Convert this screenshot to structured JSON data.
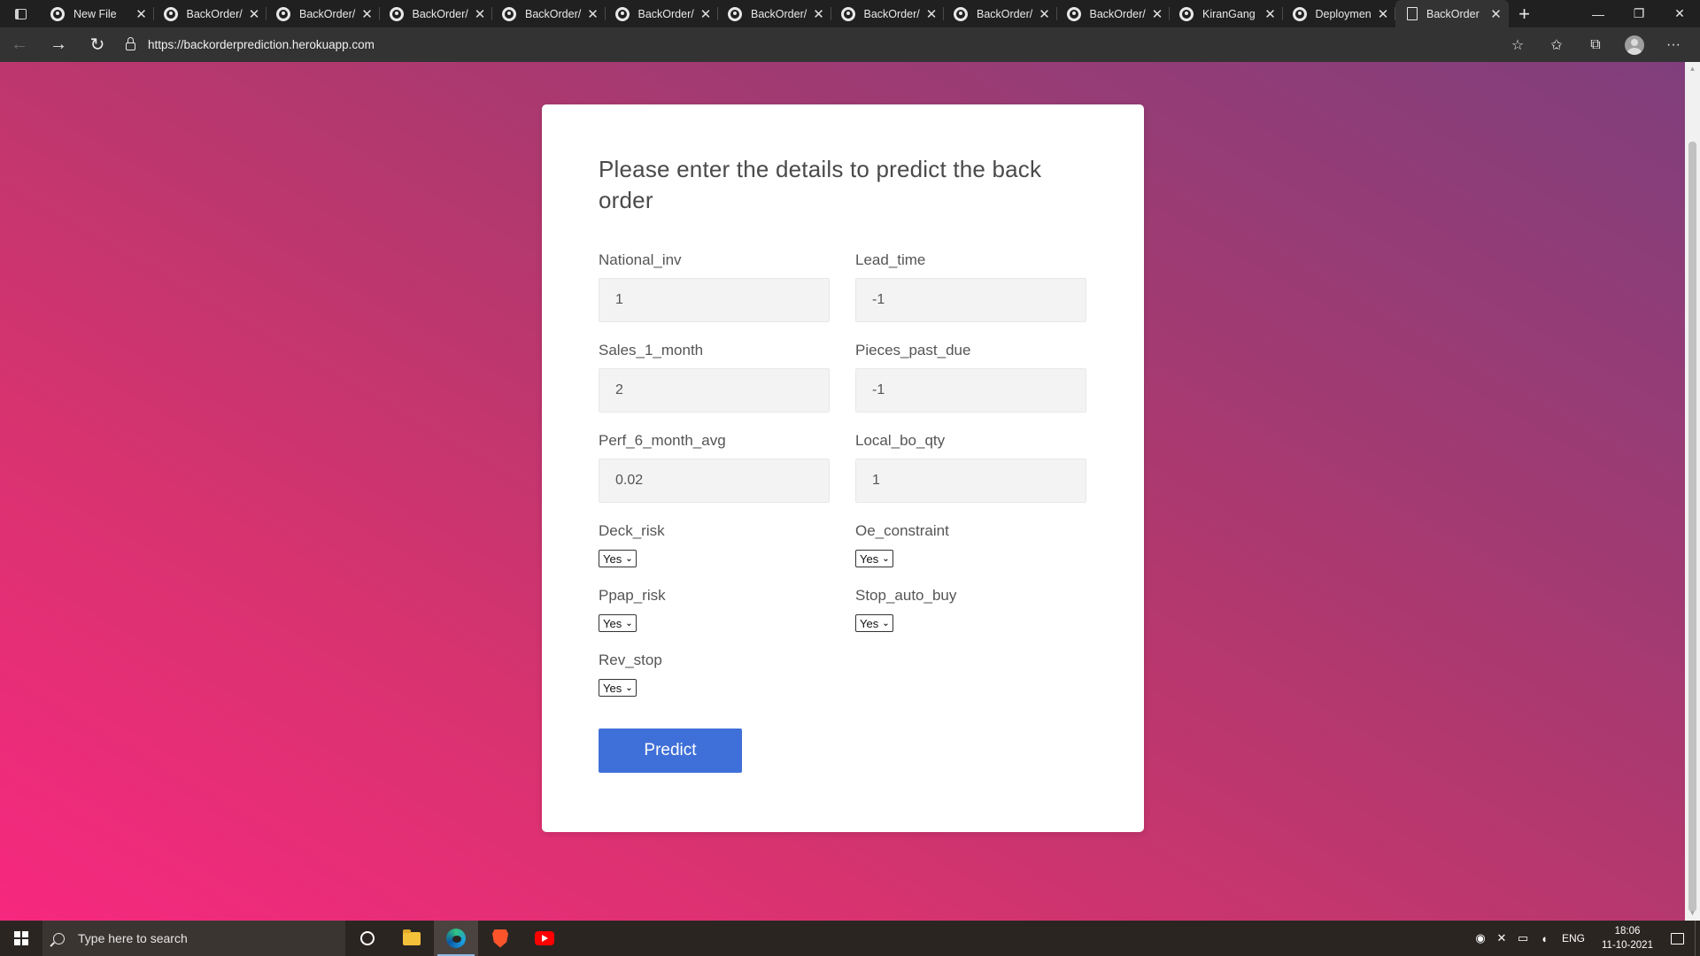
{
  "browser": {
    "tabs": [
      {
        "title": "New File",
        "icon": "github-icon",
        "active": false
      },
      {
        "title": "BackOrder/",
        "icon": "github-icon",
        "active": false
      },
      {
        "title": "BackOrder/",
        "icon": "github-icon",
        "active": false
      },
      {
        "title": "BackOrder/",
        "icon": "github-icon",
        "active": false
      },
      {
        "title": "BackOrder/",
        "icon": "github-icon",
        "active": false
      },
      {
        "title": "BackOrder/",
        "icon": "github-icon",
        "active": false
      },
      {
        "title": "BackOrder/",
        "icon": "github-icon",
        "active": false
      },
      {
        "title": "BackOrder/",
        "icon": "github-icon",
        "active": false
      },
      {
        "title": "BackOrder/",
        "icon": "github-icon",
        "active": false
      },
      {
        "title": "BackOrder/",
        "icon": "github-icon",
        "active": false
      },
      {
        "title": "KiranGang",
        "icon": "github-icon",
        "active": false
      },
      {
        "title": "Deploymen",
        "icon": "github-icon",
        "active": false
      },
      {
        "title": "BackOrder",
        "icon": "document-icon",
        "active": true
      }
    ],
    "url": "https://backorderprediction.herokuapp.com"
  },
  "form": {
    "heading": "Please enter the details to predict the back order",
    "fields": {
      "national_inv": {
        "label": "National_inv",
        "value": "1"
      },
      "lead_time": {
        "label": "Lead_time",
        "value": "-1"
      },
      "sales_1_month": {
        "label": "Sales_1_month",
        "value": "2"
      },
      "pieces_past_due": {
        "label": "Pieces_past_due",
        "value": "-1"
      },
      "perf_6_month_avg": {
        "label": "Perf_6_month_avg",
        "value": "0.02"
      },
      "local_bo_qty": {
        "label": "Local_bo_qty",
        "value": "1"
      }
    },
    "selects": {
      "deck_risk": {
        "label": "Deck_risk",
        "value": "Yes"
      },
      "oe_constraint": {
        "label": "Oe_constraint",
        "value": "Yes"
      },
      "ppap_risk": {
        "label": "Ppap_risk",
        "value": "Yes"
      },
      "stop_auto_buy": {
        "label": "Stop_auto_buy",
        "value": "Yes"
      },
      "rev_stop": {
        "label": "Rev_stop",
        "value": "Yes"
      }
    },
    "submit_label": "Predict"
  },
  "taskbar": {
    "search_placeholder": "Type here to search",
    "language": "ENG",
    "time": "18:06",
    "date": "11-10-2021"
  },
  "colors": {
    "primary_button": "#3f6fd8",
    "gradient_start": "#f7287f",
    "gradient_end": "#7f3f7c"
  }
}
